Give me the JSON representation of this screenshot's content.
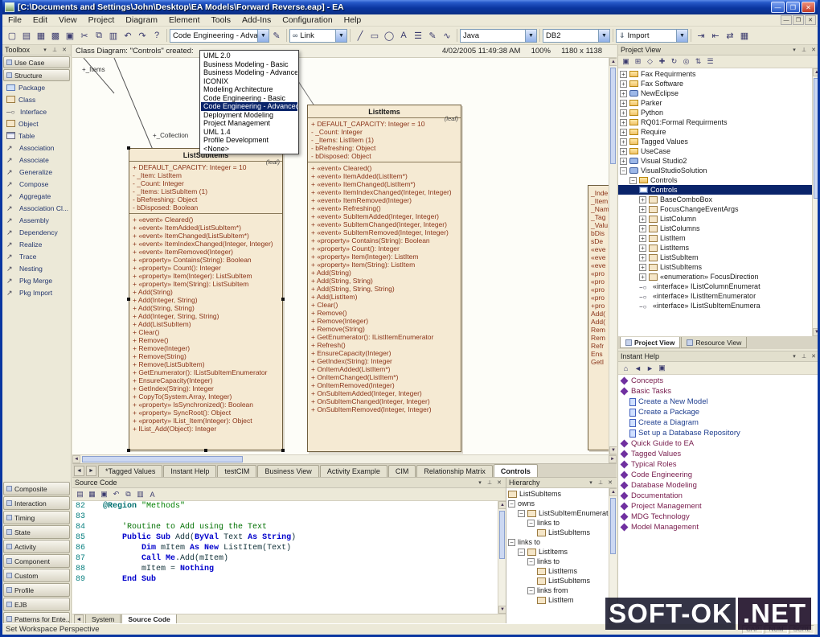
{
  "colors": {
    "titlebar_blue": "#0a36a0",
    "selection_navy": "#0a246a",
    "class_fill": "#f5ead3",
    "class_border": "#6f5f3f",
    "member_text": "#8a3318",
    "close_red": "#c03a28"
  },
  "window": {
    "title": "[C:\\Documents and Settings\\John\\Desktop\\EA Models\\Forward Reverse.eap] - EA",
    "buttons": {
      "minimize": "—",
      "maximize": "❐",
      "close": "✕"
    }
  },
  "menu": {
    "items": [
      "File",
      "Edit",
      "View",
      "Project",
      "Diagram",
      "Element",
      "Tools",
      "Add-Ins",
      "Configuration",
      "Help"
    ],
    "mdi_buttons": [
      {
        "name": "mdi-minimize-icon",
        "g": "—"
      },
      {
        "name": "mdi-restore-icon",
        "g": "❐"
      },
      {
        "name": "mdi-close-icon",
        "g": "✕"
      }
    ]
  },
  "toolbar": {
    "left_icons": [
      {
        "name": "new-project-icon",
        "g": "▢"
      },
      {
        "name": "open-project-icon",
        "g": "▤"
      },
      {
        "name": "save-icon",
        "g": "▦"
      },
      {
        "name": "save-all-icon",
        "g": "▩"
      },
      {
        "name": "print-icon",
        "g": "▣"
      },
      {
        "name": "cut-icon",
        "g": "✂"
      },
      {
        "name": "copy-icon",
        "g": "⧉"
      },
      {
        "name": "paste-icon",
        "g": "▥"
      },
      {
        "name": "undo-icon",
        "g": "↶"
      },
      {
        "name": "redo-icon",
        "g": "↷"
      },
      {
        "name": "help-icon",
        "g": "?"
      }
    ],
    "profile_combo": "Code Engineering - Advan",
    "edit_icon": "✎",
    "link_combo": {
      "icon": "∞",
      "label": "Link"
    },
    "shape_icons": [
      {
        "name": "line-tool-icon",
        "g": "╱"
      },
      {
        "name": "rectangle-tool-icon",
        "g": "▭"
      },
      {
        "name": "ellipse-tool-icon",
        "g": "◯"
      },
      {
        "name": "text-tool-icon",
        "g": "A"
      },
      {
        "name": "note-tool-icon",
        "g": "☰"
      },
      {
        "name": "pen-tool-icon",
        "g": "✎"
      },
      {
        "name": "freehand-tool-icon",
        "g": "∿"
      }
    ],
    "lang_combo": "Java",
    "db_combo": "DB2",
    "import_combo": {
      "icon": "⇓",
      "label": "Import"
    },
    "right_icons": [
      {
        "name": "import-source-icon",
        "g": "⇥"
      },
      {
        "name": "export-source-icon",
        "g": "⇤"
      },
      {
        "name": "synchronize-icon",
        "g": "⇄"
      },
      {
        "name": "generate-code-icon",
        "g": "▦"
      }
    ]
  },
  "profile_dropdown": {
    "items": [
      {
        "label": "UML 2.0",
        "cls": ""
      },
      {
        "label": "Business Modeling - Basic",
        "cls": ""
      },
      {
        "label": "Business Modeling - Advanced",
        "cls": ""
      },
      {
        "label": "ICONIX",
        "cls": ""
      },
      {
        "label": "Modeling Architecture",
        "cls": ""
      },
      {
        "label": "Code Engineering - Basic",
        "cls": ""
      },
      {
        "label": "Code Engineering - Advanced",
        "cls": "selected"
      },
      {
        "label": "Deployment Modeling",
        "cls": ""
      },
      {
        "label": "Project Management",
        "cls": ""
      },
      {
        "label": "UML 1.4",
        "cls": ""
      },
      {
        "label": "Profile Development",
        "cls": ""
      },
      {
        "label": "<None>",
        "cls": ""
      }
    ]
  },
  "toolbox": {
    "title": "Toolbox",
    "sections_top": [
      "Use Case",
      "Structure"
    ],
    "items": [
      {
        "label": "Package",
        "cls": "ic-tb-pkg"
      },
      {
        "label": "Class",
        "cls": "ic-tb-class"
      },
      {
        "label": "Interface",
        "cls": "ic-tb-iface"
      },
      {
        "label": "Object",
        "cls": "ic-tb-class"
      },
      {
        "label": "Table",
        "cls": "ic-tb-table"
      },
      {
        "label": "Association",
        "cls": "ic-tb-arrow"
      },
      {
        "label": "Associate",
        "cls": "ic-tb-arrow"
      },
      {
        "label": "Generalize",
        "cls": "ic-tb-arrow"
      },
      {
        "label": "Compose",
        "cls": "ic-tb-arrow"
      },
      {
        "label": "Aggregate",
        "cls": "ic-tb-arrow"
      },
      {
        "label": "Association Cl...",
        "cls": "ic-tb-arrow"
      },
      {
        "label": "Assembly",
        "cls": "ic-tb-arrow"
      },
      {
        "label": "Dependency",
        "cls": "ic-tb-arrow"
      },
      {
        "label": "Realize",
        "cls": "ic-tb-arrow"
      },
      {
        "label": "Trace",
        "cls": "ic-tb-arrow"
      },
      {
        "label": "Nesting",
        "cls": "ic-tb-arrow"
      },
      {
        "label": "Pkg Merge",
        "cls": "ic-tb-arrow"
      },
      {
        "label": "Pkg Import",
        "cls": "ic-tb-arrow"
      }
    ],
    "sections_bottom": [
      "Composite",
      "Interaction",
      "Timing",
      "State",
      "Activity",
      "Component",
      "Custom",
      "Profile",
      "EJB",
      "Patterns for Ente..."
    ]
  },
  "diagram": {
    "header_left": "Class Diagram: \"Controls\" created:",
    "header_right": "4/02/2005 11:49:38 AM     100%     1180 x 1138",
    "connector_label_top": "+_Items",
    "connector_label_box": "+_Collection",
    "classes": [
      {
        "name": "ListSubItems",
        "stereotype": "(leaf)",
        "attributes": [
          "+ DEFAULT_CAPACITY:  Integer = 10",
          "-  _Item:  ListItem",
          "-  _Count:  Integer",
          "-  _Items:  ListSubItem (1)",
          "-  bRefreshing:  Object",
          "-  bDisposed:  Boolean"
        ],
        "methods": [
          "+ «event» Cleared()",
          "+ «event» ItemAdded(ListSubItem*)",
          "+ «event» ItemChanged(ListSubItem*)",
          "+ «event» ItemIndexChanged(Integer, Integer)",
          "+ «event» ItemRemoved(Integer)",
          "+ «property» Contains(String):  Boolean",
          "+ «property» Count():  Integer",
          "+ «property» Item(Integer):  ListSubItem",
          "+ «property» Item(String):  ListSubItem",
          "+ Add(String)",
          "+ Add(Integer, String)",
          "+ Add(String, String)",
          "+ Add(Integer, String, String)",
          "+ Add(ListSubItem)",
          "+ Clear()",
          "+ Remove()",
          "+ Remove(Integer)",
          "+ Remove(String)",
          "+ Remove(ListSubItem)",
          "+ GetEnumerator():  IListSubItemEnumerator",
          "+ EnsureCapacity(Integer)",
          "+ GetIndex(String):  Integer",
          "+ CopyTo(System.Array, Integer)",
          "+ «property» IsSynchronized():  Boolean",
          "+ «property» SyncRoot():  Object",
          "+ «property» IList_Item(Integer):  Object",
          "+ IList_Add(Object):  Integer"
        ]
      },
      {
        "name": "ListItems",
        "stereotype": "(leaf)",
        "attributes": [
          "+ DEFAULT_CAPACITY:  Integer = 10",
          "-  _Count:  Integer",
          "-  _Items:  ListItem (1)",
          "-  bRefreshing:  Object",
          "-  bDisposed:  Object"
        ],
        "methods": [
          "+ «event» Cleared()",
          "+ «event» ItemAdded(ListItem*)",
          "+ «event» ItemChanged(ListItem*)",
          "+ «event» ItemIndexChanged(Integer, Integer)",
          "+ «event» ItemRemoved(Integer)",
          "+ «event» Refreshing()",
          "+ «event» SubItemAdded(Integer, Integer)",
          "+ «event» SubItemChanged(Integer, Integer)",
          "+ «event» SubItemRemoved(Integer, Integer)",
          "+ «property» Contains(String):  Boolean",
          "+ «property» Count():  Integer",
          "+ «property» Item(Integer):  ListItem",
          "+ «property» Item(String):  ListItem",
          "+ Add(String)",
          "+ Add(String, String)",
          "+ Add(String, String, String)",
          "+ Add(ListItem)",
          "+ Clear()",
          "+ Remove()",
          "+ Remove(Integer)",
          "+ Remove(String)",
          "+ GetEnumerator():  IListItemEnumerator",
          "+ Refresh()",
          "+ EnsureCapacity(Integer)",
          "+ GetIndex(String):  Integer",
          "+ OnItemAdded(ListItem*)",
          "+ OnItemChanged(ListItem*)",
          "+ OnItemRemoved(Integer)",
          "+ OnSubItemAdded(Integer, Integer)",
          "+ OnSubItemChanged(Integer, Integer)",
          "+ OnSubItemRemoved(Integer, Integer)"
        ]
      }
    ],
    "partial_fragments": [
      "_Inde",
      "_Item",
      "_Nam",
      "_Tag",
      "_Valu",
      "bDis",
      "sDe",
      "«eve",
      "«eve",
      "«eve",
      "«pro",
      "«pro",
      "«pro",
      "«pro",
      "+pro",
      "Add(",
      "Add(",
      "Rem",
      "Rem",
      "Refr",
      "Ens",
      "GetI"
    ]
  },
  "doc_tabs": {
    "items": [
      {
        "label": "*Tagged Values",
        "cls": ""
      },
      {
        "label": "Instant Help",
        "cls": ""
      },
      {
        "label": "testCIM",
        "cls": ""
      },
      {
        "label": "Business View",
        "cls": ""
      },
      {
        "label": "Activity Example",
        "cls": ""
      },
      {
        "label": "CIM",
        "cls": ""
      },
      {
        "label": "Relationship Matrix",
        "cls": ""
      },
      {
        "label": "Controls",
        "cls": "active"
      }
    ]
  },
  "source_code": {
    "title": "Source Code",
    "toolbar_icons": [
      {
        "name": "open-icon",
        "g": "▤"
      },
      {
        "name": "save-icon",
        "g": "▦"
      },
      {
        "name": "print-icon",
        "g": "▣"
      },
      {
        "name": "undo-icon",
        "g": "↶"
      },
      {
        "name": "copy-icon",
        "g": "⧉"
      },
      {
        "name": "paste-icon",
        "g": "▥"
      },
      {
        "name": "font-icon",
        "g": "A"
      }
    ],
    "lines": [
      {
        "num": "82",
        "tokens": [
          {
            "c": "kw2",
            "s": "  @Region "
          },
          {
            "c": "str",
            "s": "\"Methods\""
          }
        ]
      },
      {
        "num": "83",
        "tokens": []
      },
      {
        "num": "84",
        "tokens": [
          {
            "c": "com",
            "s": "      'Routine to Add using the Text"
          }
        ]
      },
      {
        "num": "85",
        "tokens": [
          {
            "c": "kw",
            "s": "      Public Sub "
          },
          {
            "c": "id",
            "s": "Add("
          },
          {
            "c": "kw",
            "s": "ByVal "
          },
          {
            "c": "id",
            "s": "Text "
          },
          {
            "c": "kw",
            "s": "As String"
          },
          {
            "c": "id",
            "s": ")"
          }
        ]
      },
      {
        "num": "86",
        "tokens": [
          {
            "c": "id",
            "s": "          "
          },
          {
            "c": "kw",
            "s": "Dim "
          },
          {
            "c": "id",
            "s": "mItem "
          },
          {
            "c": "kw",
            "s": "As New "
          },
          {
            "c": "id",
            "s": "ListItem(Text)"
          }
        ]
      },
      {
        "num": "87",
        "tokens": [
          {
            "c": "id",
            "s": "          "
          },
          {
            "c": "kw",
            "s": "Call Me"
          },
          {
            "c": "id",
            "s": ".Add(mItem)"
          }
        ]
      },
      {
        "num": "88",
        "tokens": [
          {
            "c": "id",
            "s": "          mItem = "
          },
          {
            "c": "kw",
            "s": "Nothing"
          }
        ]
      },
      {
        "num": "89",
        "tokens": [
          {
            "c": "kw",
            "s": "      End Sub"
          }
        ]
      }
    ],
    "tabs": [
      {
        "label": "System",
        "cls": ""
      },
      {
        "label": "Source Code",
        "cls": "active"
      }
    ]
  },
  "hierarchy": {
    "title": "Hierarchy",
    "items": [
      {
        "label": "ListSubItems",
        "cls": "i0 ic-class"
      },
      {
        "label": "owns",
        "cls": "i0 em ic-none"
      },
      {
        "label": "ListSubItemEnumerator",
        "cls": "i1 em ic-class"
      },
      {
        "label": "links to",
        "cls": "i2 em ic-none"
      },
      {
        "label": "ListSubItems",
        "cls": "i3 ic-class"
      },
      {
        "label": "links to",
        "cls": "i0 em ic-none"
      },
      {
        "label": "ListItems",
        "cls": "i1 em ic-class"
      },
      {
        "label": "links to",
        "cls": "i2 em ic-none"
      },
      {
        "label": "ListItems",
        "cls": "i3 ic-class"
      },
      {
        "label": "ListSubItems",
        "cls": "i3 ic-class"
      },
      {
        "label": "links from",
        "cls": "i2 em ic-none"
      },
      {
        "label": "ListItem",
        "cls": "i3 ic-class"
      }
    ]
  },
  "project_view": {
    "title": "Project View",
    "toolbar_icons": [
      {
        "name": "new-model-icon",
        "g": "▣"
      },
      {
        "name": "new-package-icon",
        "g": "⊞"
      },
      {
        "name": "new-diagram-icon",
        "g": "◇"
      },
      {
        "name": "new-element-icon",
        "g": "✚"
      },
      {
        "name": "refresh-icon",
        "g": "↻"
      },
      {
        "name": "find-icon",
        "g": "◎"
      },
      {
        "name": "collapse-all-icon",
        "g": "⇅"
      },
      {
        "name": "properties-icon",
        "g": "☰"
      }
    ],
    "tree": [
      {
        "label": "Fax Requirments",
        "cls": "i0 ep ic-folder"
      },
      {
        "label": "Fax Software",
        "cls": "i0 ep ic-folder"
      },
      {
        "label": "NewEclipse",
        "cls": "i0 ep ic-model"
      },
      {
        "label": "Parker",
        "cls": "i0 ep ic-folder"
      },
      {
        "label": "Python",
        "cls": "i0 ep ic-folder"
      },
      {
        "label": "RQ01:Formal Requirments",
        "cls": "i0 ep ic-folder"
      },
      {
        "label": "Require",
        "cls": "i0 ep ic-folder"
      },
      {
        "label": "Tagged Values",
        "cls": "i0 ep ic-folder"
      },
      {
        "label": "UseCase",
        "cls": "i0 ep ic-folder"
      },
      {
        "label": "Visual Studio2",
        "cls": "i0 ep ic-model"
      },
      {
        "label": "VisualStudioSolution",
        "cls": "i0 em ic-model"
      },
      {
        "label": "Controls",
        "cls": "i1 em ic-folder"
      },
      {
        "label": "Controls",
        "cls": "i2 ic-diagram selected"
      },
      {
        "label": "BaseComboBox",
        "cls": "i2 ep ic-class"
      },
      {
        "label": "FocusChangeEventArgs",
        "cls": "i2 ep ic-class"
      },
      {
        "label": "ListColumn",
        "cls": "i2 ep ic-class"
      },
      {
        "label": "ListColumns",
        "cls": "i2 ep ic-class"
      },
      {
        "label": "ListItem",
        "cls": "i2 ep ic-class"
      },
      {
        "label": "ListItems",
        "cls": "i2 ep ic-class"
      },
      {
        "label": "ListSubItem",
        "cls": "i2 ep ic-class"
      },
      {
        "label": "ListSubItems",
        "cls": "i2 ep ic-class"
      },
      {
        "label": "«enumeration» FocusDirection",
        "cls": "i2 ep ic-class"
      },
      {
        "label": "«interface» IListColumnEnumerat",
        "cls": "i2 ic-iface"
      },
      {
        "label": "«interface» IListItemEnumerator",
        "cls": "i2 ic-iface"
      },
      {
        "label": "«interface» IListSubItemEnumera",
        "cls": "i2 ic-iface"
      }
    ],
    "tabs": [
      {
        "label": "Project View",
        "cls": "active"
      },
      {
        "label": "Resource View",
        "cls": ""
      }
    ]
  },
  "instant_help": {
    "title": "Instant Help",
    "toolbar_icons": [
      {
        "name": "home-icon",
        "g": "⌂"
      },
      {
        "name": "back-icon",
        "g": "◄"
      },
      {
        "name": "forward-icon",
        "g": "►"
      },
      {
        "name": "print-icon",
        "g": "▣"
      }
    ],
    "items": [
      {
        "label": "Concepts",
        "cls": "ih-cat ic-diamond"
      },
      {
        "label": "Basic Tasks",
        "cls": "ih-cat ic-diamond"
      },
      {
        "label": "Create a New Model",
        "cls": "ih-doc ic-doc i1"
      },
      {
        "label": "Create a Package",
        "cls": "ih-doc ic-doc i1"
      },
      {
        "label": "Create a Diagram",
        "cls": "ih-doc ic-doc i1"
      },
      {
        "label": "Set up a Database Repository",
        "cls": "ih-doc ic-doc i1"
      },
      {
        "label": "Quick Guide to EA",
        "cls": "ih-cat ic-diamond"
      },
      {
        "label": "Tagged Values",
        "cls": "ih-cat ic-diamond"
      },
      {
        "label": "Typical Roles",
        "cls": "ih-cat ic-diamond"
      },
      {
        "label": "Code Engineering",
        "cls": "ih-cat ic-diamond"
      },
      {
        "label": "Database Modeling",
        "cls": "ih-cat ic-diamond"
      },
      {
        "label": "Documentation",
        "cls": "ih-cat ic-diamond"
      },
      {
        "label": "Project Management",
        "cls": "ih-cat ic-diamond"
      },
      {
        "label": "MDG Technology",
        "cls": "ih-cat ic-diamond"
      },
      {
        "label": "Model Management",
        "cls": "ih-cat ic-diamond"
      }
    ]
  },
  "statusbar": {
    "left": "Set Workspace Perspective",
    "cells": [
      "CAP",
      "NUM",
      "SCRL"
    ]
  },
  "watermark": {
    "text": "SOFT-OK",
    "suffix": ".NET"
  }
}
